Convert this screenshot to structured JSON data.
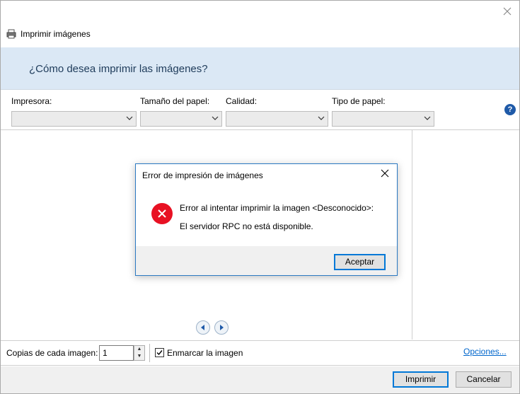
{
  "window": {
    "title": "Imprimir imágenes",
    "heading": "¿Cómo desea imprimir las imágenes?"
  },
  "icons": {
    "app": "printer-icon",
    "close": "close-icon",
    "help": "help-icon",
    "error": "error-icon"
  },
  "options": {
    "printer_label": "Impresora:",
    "paper_size_label": "Tamaño del papel:",
    "quality_label": "Calidad:",
    "paper_type_label": "Tipo de papel:",
    "printer_value": "",
    "paper_size_value": "",
    "quality_value": "",
    "paper_type_value": ""
  },
  "bottom": {
    "copies_label": "Copias de cada imagen:",
    "copies_value": "1",
    "frame_label": "Enmarcar la imagen",
    "frame_checked": true,
    "options_link": "Opciones..."
  },
  "footer": {
    "print_label": "Imprimir",
    "cancel_label": "Cancelar"
  },
  "dialog": {
    "title": "Error de impresión de imágenes",
    "message_line1": "Error al intentar imprimir la imagen <Desconocido>:",
    "message_line2": "El servidor RPC no está disponible.",
    "ok_label": "Aceptar"
  },
  "colors": {
    "banner": "#dbe8f5",
    "accent": "#0078d7",
    "error": "#e81123",
    "link": "#0066cc"
  }
}
